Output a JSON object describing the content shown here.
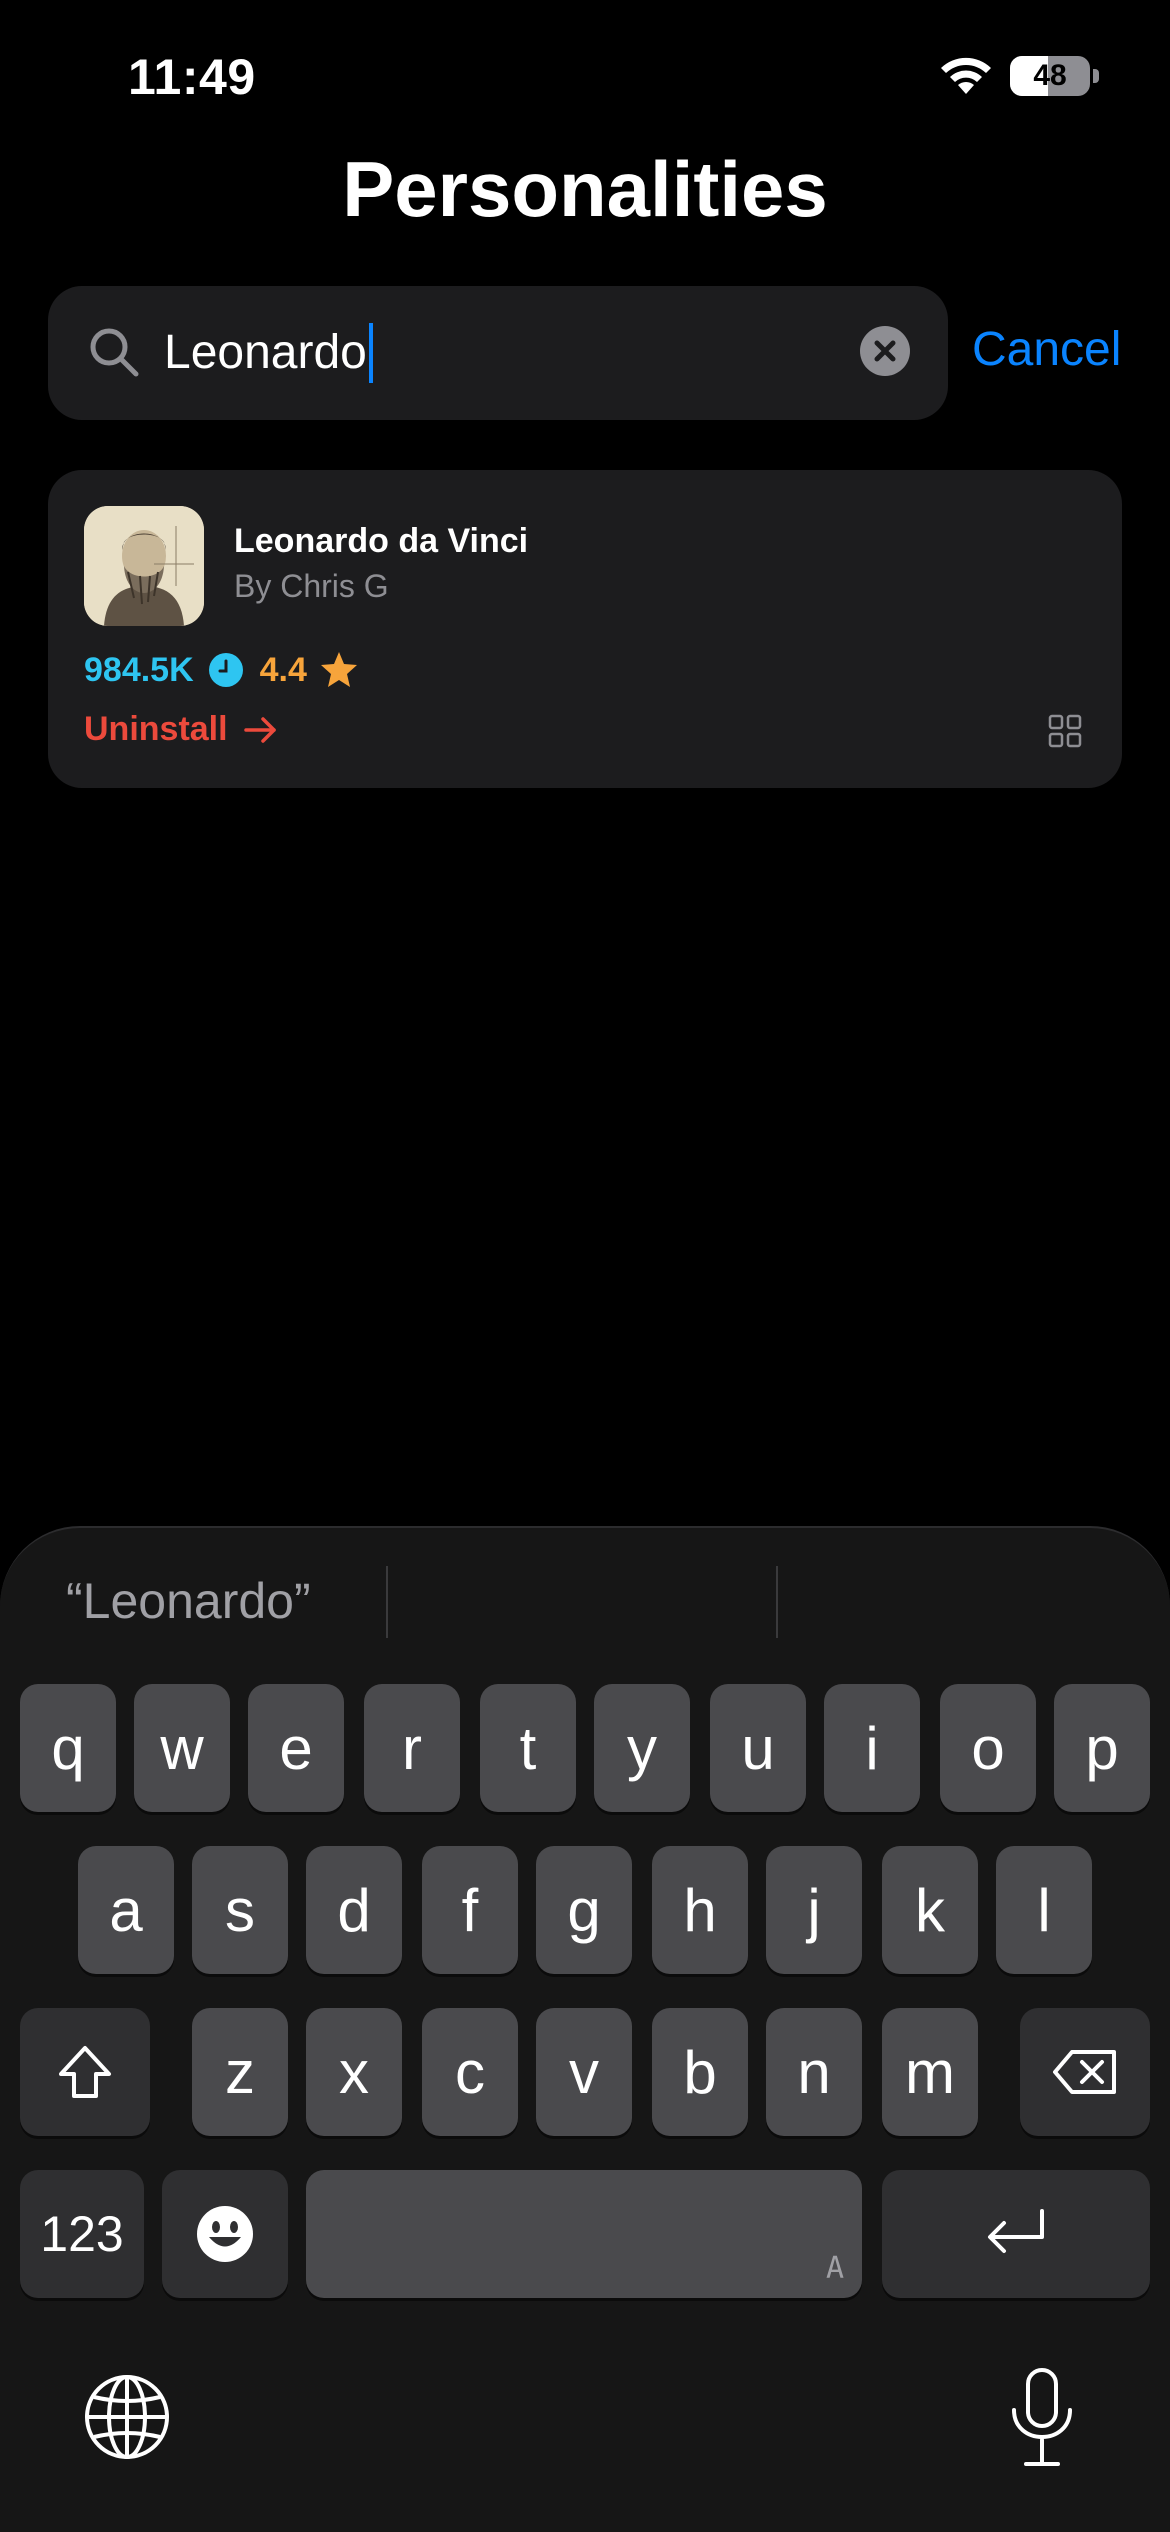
{
  "status_bar": {
    "time": "11:49",
    "battery": "48",
    "battery_level": 0.48
  },
  "title": "Personalities",
  "search": {
    "value": "Leonardo",
    "cancel_label": "Cancel"
  },
  "result": {
    "name": "Leonardo da Vinci",
    "author": "By Chris G",
    "count": "984.5K",
    "rating": "4.4",
    "action_label": "Uninstall"
  },
  "keyboard": {
    "suggestions": [
      "“Leonardo”",
      "",
      ""
    ],
    "row1": [
      "q",
      "w",
      "e",
      "r",
      "t",
      "y",
      "u",
      "i",
      "o",
      "p"
    ],
    "row2": [
      "a",
      "s",
      "d",
      "f",
      "g",
      "h",
      "j",
      "k",
      "l"
    ],
    "row3": [
      "z",
      "x",
      "c",
      "v",
      "b",
      "n",
      "m"
    ],
    "numbers_label": "123",
    "space_mark": "A"
  },
  "colors": {
    "accent": "#0a84ff",
    "count": "#2ec5f1",
    "rating": "#f7a43b",
    "danger": "#ec4a3c"
  },
  "icons": [
    "wifi-icon",
    "search-icon",
    "clear-icon",
    "clock-icon",
    "star-icon",
    "arrow-right-icon",
    "grid-icon",
    "shift-icon",
    "backspace-icon",
    "emoji-icon",
    "return-icon",
    "globe-icon",
    "microphone-icon"
  ]
}
